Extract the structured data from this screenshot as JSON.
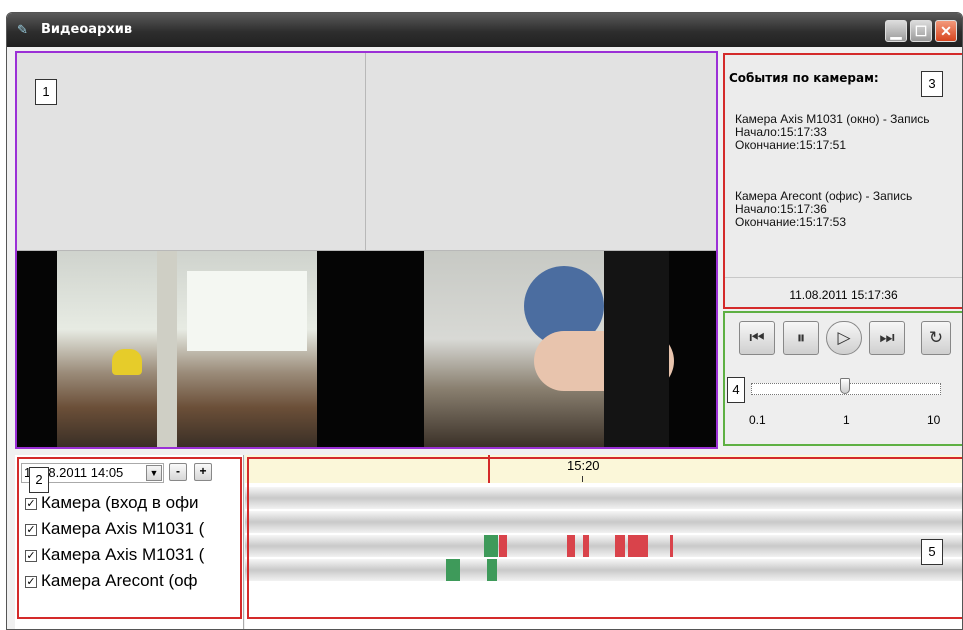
{
  "window": {
    "title": "Видеоархив",
    "icon": "camera-icon"
  },
  "labels": {
    "video": "1",
    "cameras": "2",
    "events": "3",
    "player": "4",
    "timeline": "5"
  },
  "events": {
    "header": "События по камерам:",
    "items": [
      {
        "title": "Камера Axis M1031 (окно) - Запись",
        "start": "Начало:15:17:33",
        "end": "Окончание:15:17:51"
      },
      {
        "title": "Камера Arecont (офис) - Запись",
        "start": "Начало:15:17:36",
        "end": "Окончание:15:17:53"
      }
    ],
    "footer": "11.08.2011 15:17:36"
  },
  "player": {
    "buttons": [
      "skip-back",
      "pause",
      "play",
      "skip-forward",
      "refresh"
    ],
    "speed_labels": [
      "0.1",
      "1",
      "10"
    ],
    "speed_value": 1
  },
  "camera_list": {
    "date": "11.08.2011 14:05",
    "zoom_out": "-",
    "zoom_in": "+",
    "cameras": [
      {
        "label": "Камера (вход в офи",
        "checked": true
      },
      {
        "label": "Камера Axis M1031 (",
        "checked": true
      },
      {
        "label": "Камера Axis M1031 (",
        "checked": true
      },
      {
        "label": "Камера Arecont (оф",
        "checked": true
      }
    ]
  },
  "timeline": {
    "ruler_label": "15:20",
    "colors": {
      "record": "#d9434b",
      "motion": "#3e9a5a"
    }
  }
}
